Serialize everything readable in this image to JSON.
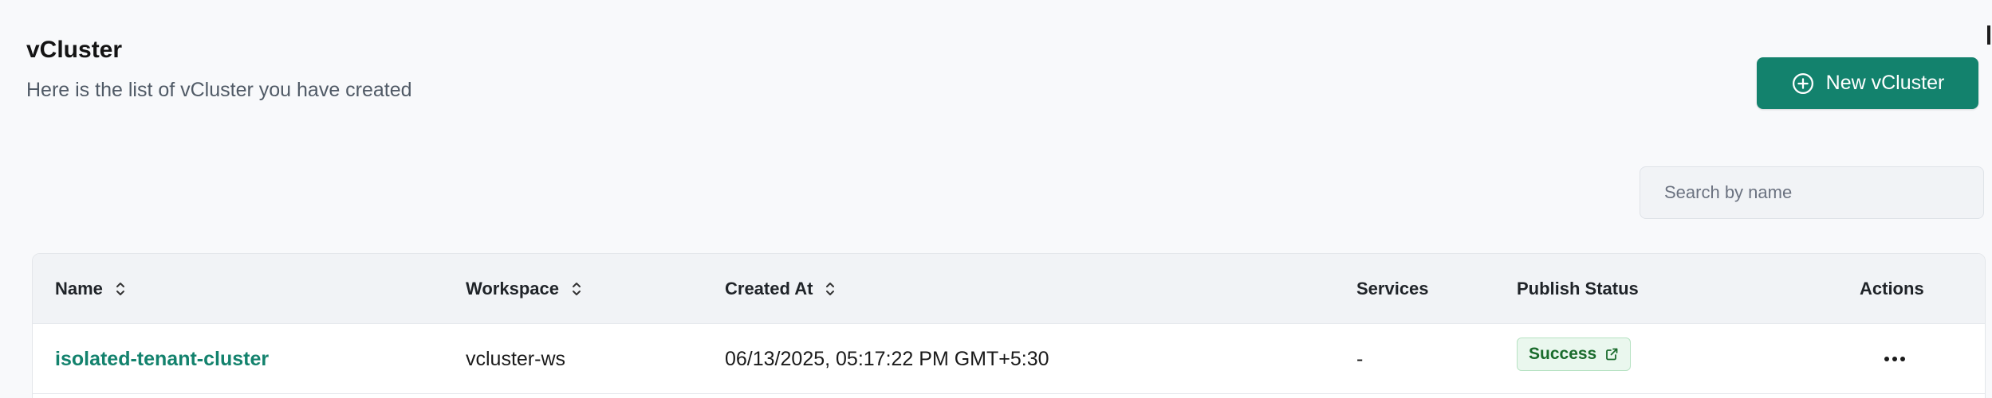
{
  "header": {
    "title": "vCluster",
    "subtitle": "Here is the list of vCluster you have created"
  },
  "toolbar": {
    "new_label": "New vCluster",
    "new_icon": "plus-circle-icon"
  },
  "search": {
    "placeholder": "Search by name",
    "value": ""
  },
  "table": {
    "columns": {
      "name": "Name",
      "workspace": "Workspace",
      "created_at": "Created At",
      "services": "Services",
      "publish_status": "Publish Status",
      "actions": "Actions"
    },
    "rows": [
      {
        "name": "isolated-tenant-cluster",
        "workspace": "vcluster-ws",
        "created_at": "06/13/2025, 05:17:22 PM GMT+5:30",
        "services": "-",
        "publish_status": "Success",
        "actions_icon": "more-horizontal-icon"
      }
    ]
  },
  "colors": {
    "accent": "#13826d",
    "success_bg": "#eaf7ee",
    "success_text": "#1a6b2c",
    "background": "#f8f9fb"
  }
}
